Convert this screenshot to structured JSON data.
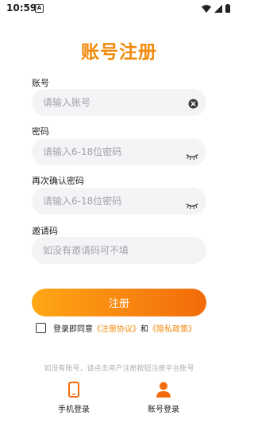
{
  "status_bar": {
    "time": "10:59",
    "a_icon": "A"
  },
  "page": {
    "title": "账号注册"
  },
  "form": {
    "account": {
      "label": "账号",
      "placeholder": "请输入账号",
      "value": ""
    },
    "password": {
      "label": "密码",
      "placeholder": "请输入6-18位密码",
      "value": ""
    },
    "confirm_password": {
      "label": "再次确认密码",
      "placeholder": "请输入6-18位密码",
      "value": ""
    },
    "invite_code": {
      "label": "邀请码",
      "placeholder": "如没有邀请码可不填",
      "value": ""
    }
  },
  "register_button": {
    "label": "注册"
  },
  "agreement": {
    "checked": false,
    "prefix": "登录即同意",
    "terms_link": "《注册协议》",
    "connector": "和",
    "privacy_link": "《隐私政策》"
  },
  "hint_text": "如没有账号，请点击用户注册按钮注册平台账号",
  "bottom_nav": {
    "items": [
      {
        "label": "手机登录",
        "icon": "phone-icon"
      },
      {
        "label": "账号登录",
        "icon": "person-icon"
      }
    ]
  },
  "colors": {
    "accent": "#f28a0c",
    "gradient_start": "#ffa716",
    "gradient_end": "#f26b0a",
    "field_bg": "#f4f4f6"
  }
}
